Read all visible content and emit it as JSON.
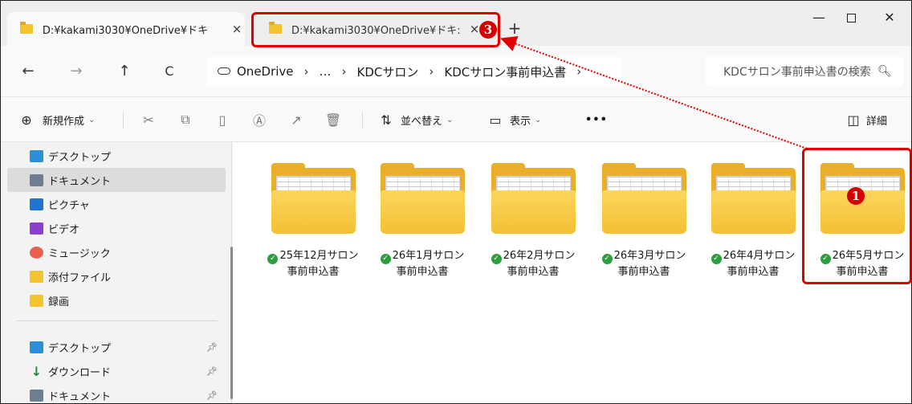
{
  "tabs": [
    {
      "title": "D:¥kakami3030¥OneDrive¥ドキ",
      "close": "×"
    },
    {
      "title": "D:¥kakami3030¥OneDrive¥ドキ:",
      "close": "×"
    }
  ],
  "new_tab": "+",
  "window_controls": {
    "minimize": "—",
    "maximize": "",
    "close": "✕"
  },
  "nav": {
    "back": "←",
    "forward": "→",
    "up": "↑",
    "refresh": "C"
  },
  "breadcrumb": {
    "items": [
      "OneDrive",
      "…",
      "KDCサロン",
      "KDCサロン事前申込書"
    ],
    "separator": "›"
  },
  "search": {
    "placeholder": "KDCサロン事前申込書の検索",
    "icon": "search-icon"
  },
  "toolbar": {
    "new_label": "新規作成",
    "sort_label": "並べ替え",
    "view_label": "表示",
    "more_label": "•••",
    "details_label": "詳細"
  },
  "sidebar": {
    "items": [
      {
        "label": "デスクトップ",
        "icon": "desktop-icon",
        "color": "#2b8fd9"
      },
      {
        "label": "ドキュメント",
        "icon": "documents-icon",
        "color": "#6e7d8f",
        "selected": true
      },
      {
        "label": "ピクチャ",
        "icon": "pictures-icon",
        "color": "#1f74d1"
      },
      {
        "label": "ビデオ",
        "icon": "videos-icon",
        "color": "#8a3fd1"
      },
      {
        "label": "ミュージック",
        "icon": "music-icon",
        "color": "#e8614c"
      },
      {
        "label": "添付ファイル",
        "icon": "folder-icon",
        "color": "#f4c430"
      },
      {
        "label": "録画",
        "icon": "folder-icon",
        "color": "#f4c430"
      }
    ],
    "quick_access": [
      {
        "label": "デスクトップ",
        "icon": "desktop-icon",
        "color": "#2b8fd9"
      },
      {
        "label": "ダウンロード",
        "icon": "download-icon",
        "color": "#1f8a3a"
      },
      {
        "label": "ドキュメント",
        "icon": "documents-icon",
        "color": "#6e7d8f"
      }
    ]
  },
  "folders": [
    {
      "line1": "25年12月サロン",
      "line2": "事前申込書",
      "status": "synced"
    },
    {
      "line1": "26年1月サロン",
      "line2": "事前申込書",
      "status": "synced"
    },
    {
      "line1": "26年2月サロン",
      "line2": "事前申込書",
      "status": "synced"
    },
    {
      "line1": "26年3月サロン",
      "line2": "事前申込書",
      "status": "synced"
    },
    {
      "line1": "26年4月サロン",
      "line2": "事前申込書",
      "status": "synced"
    },
    {
      "line1": "26年5月サロン",
      "line2": "事前申込書",
      "status": "synced"
    }
  ],
  "annotations": {
    "badge_1": "1",
    "badge_3": "3",
    "color": "#e00000"
  }
}
